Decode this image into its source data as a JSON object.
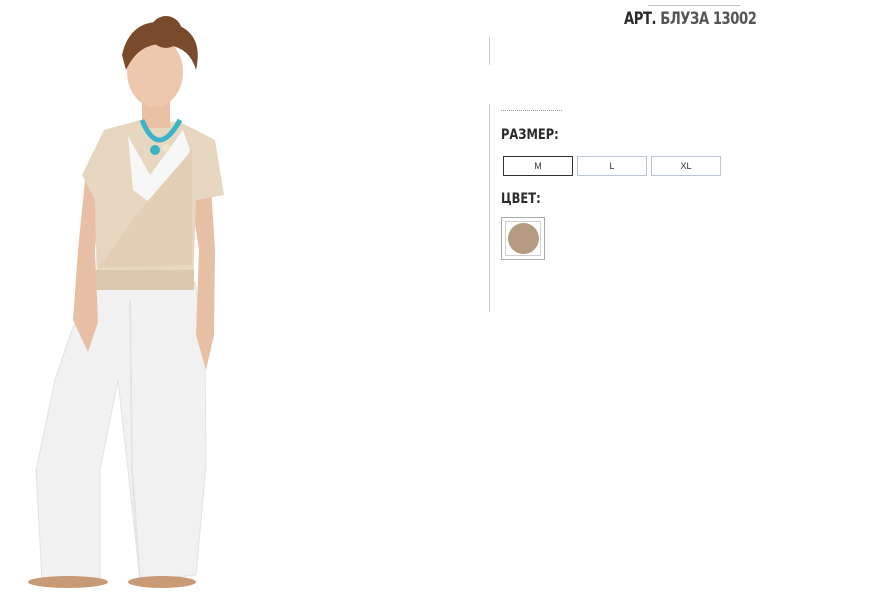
{
  "product": {
    "title_prefix": "АРТ.",
    "title_code": "БЛУЗА 13002"
  },
  "options": {
    "size_label": "РАЗМЕР:",
    "sizes": [
      "M",
      "L",
      "XL"
    ],
    "selected_size": "M",
    "color_label": "ЦВЕТ:",
    "colors": [
      {
        "hex": "#b59b82"
      }
    ]
  }
}
